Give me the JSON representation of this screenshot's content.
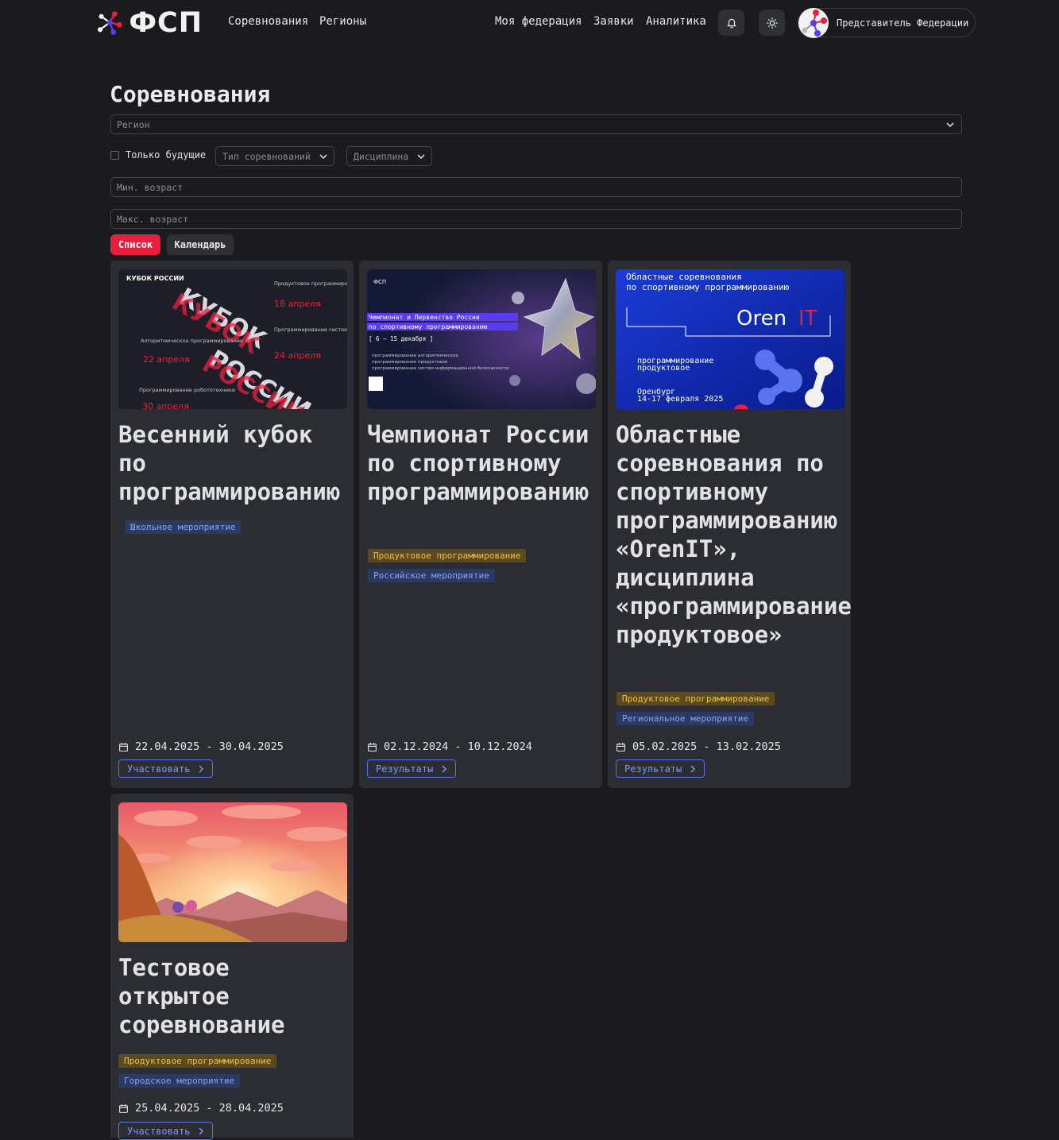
{
  "header": {
    "logo_text": "ФСП",
    "nav_left": [
      "Соревнования",
      "Регионы"
    ],
    "nav_right": [
      "Моя федерация",
      "Заявки",
      "Аналитика"
    ],
    "user_name": "Представитель Федерации"
  },
  "page": {
    "title": "Соревнования",
    "region_placeholder": "Регион",
    "only_future_label": "Только будущие",
    "only_future_checked": false,
    "type_dropdown": "Тип соревнований",
    "discipline_dropdown": "Дисциплина",
    "min_age_placeholder": "Мин. возраст",
    "max_age_placeholder": "Макс. возраст",
    "view_list": "Список",
    "view_calendar": "Календарь",
    "active_view": "Список"
  },
  "colors": {
    "accent_red": "#e8203e",
    "accent_blue": "#5a73e6",
    "tag_yellow": "#f2c14a"
  },
  "cards": [
    {
      "title": "Весенний кубок по программированию",
      "image_text": {
        "brand": "КУБОК РОССИИ",
        "big1": "КУБОК",
        "big2": "РОССИИ",
        "item1": "Продуктовое программирование",
        "date1": "18 апреля",
        "item2": "Программирование систем информационной безопасности",
        "date2": "24 апреля",
        "item3": "Алгоритмическое программирование",
        "date3": "22 апреля",
        "item4": "Программирование робототехники",
        "date4": "30 апреля"
      },
      "tags": [
        {
          "label": "Школьное мероприятие",
          "color": "blue"
        }
      ],
      "dates": "22.04.2025 - 30.04.2025",
      "button": "Участвовать"
    },
    {
      "title": "Чемпионат России по спортивному программированию",
      "image_text": {
        "line1": "Чемпионат и Первенство России",
        "line2": "по спортивному программированию",
        "dates": "[ 6 – 15 декабря ]",
        "d1": "программирование алгоритмическое",
        "d2": "программирование продуктовое",
        "d3": "программирование систем информационной безопасности"
      },
      "tags": [
        {
          "label": "Продуктовое программирование",
          "color": "yellow"
        },
        {
          "label": "Российское мероприятие",
          "color": "blue"
        }
      ],
      "dates": "02.12.2024 - 10.12.2024",
      "button": "Результаты"
    },
    {
      "title": "Областные соревнования по спортивному программированию «OrenIT», дисциплина «программирование продуктовое»",
      "image_text": {
        "heading1": "Областные соревнования",
        "heading2": "по спортивному программированию",
        "brand_a": "Oren",
        "brand_b": "IT",
        "disc1": "программирование",
        "disc2": "продуктовое",
        "city": "Оренбург",
        "dates": "14-17 февраля 2025"
      },
      "tags": [
        {
          "label": "Продуктовое программирование",
          "color": "yellow"
        },
        {
          "label": "Региональное мероприятие",
          "color": "blue"
        }
      ],
      "dates": "05.02.2025 - 13.02.2025",
      "button": "Результаты"
    },
    {
      "title": "Тестовое открытое соревнование",
      "tags": [
        {
          "label": "Продуктовое программирование",
          "color": "yellow"
        },
        {
          "label": "Городское мероприятие",
          "color": "blue"
        }
      ],
      "dates": "25.04.2025 - 28.04.2025",
      "button": "Участвовать"
    }
  ]
}
